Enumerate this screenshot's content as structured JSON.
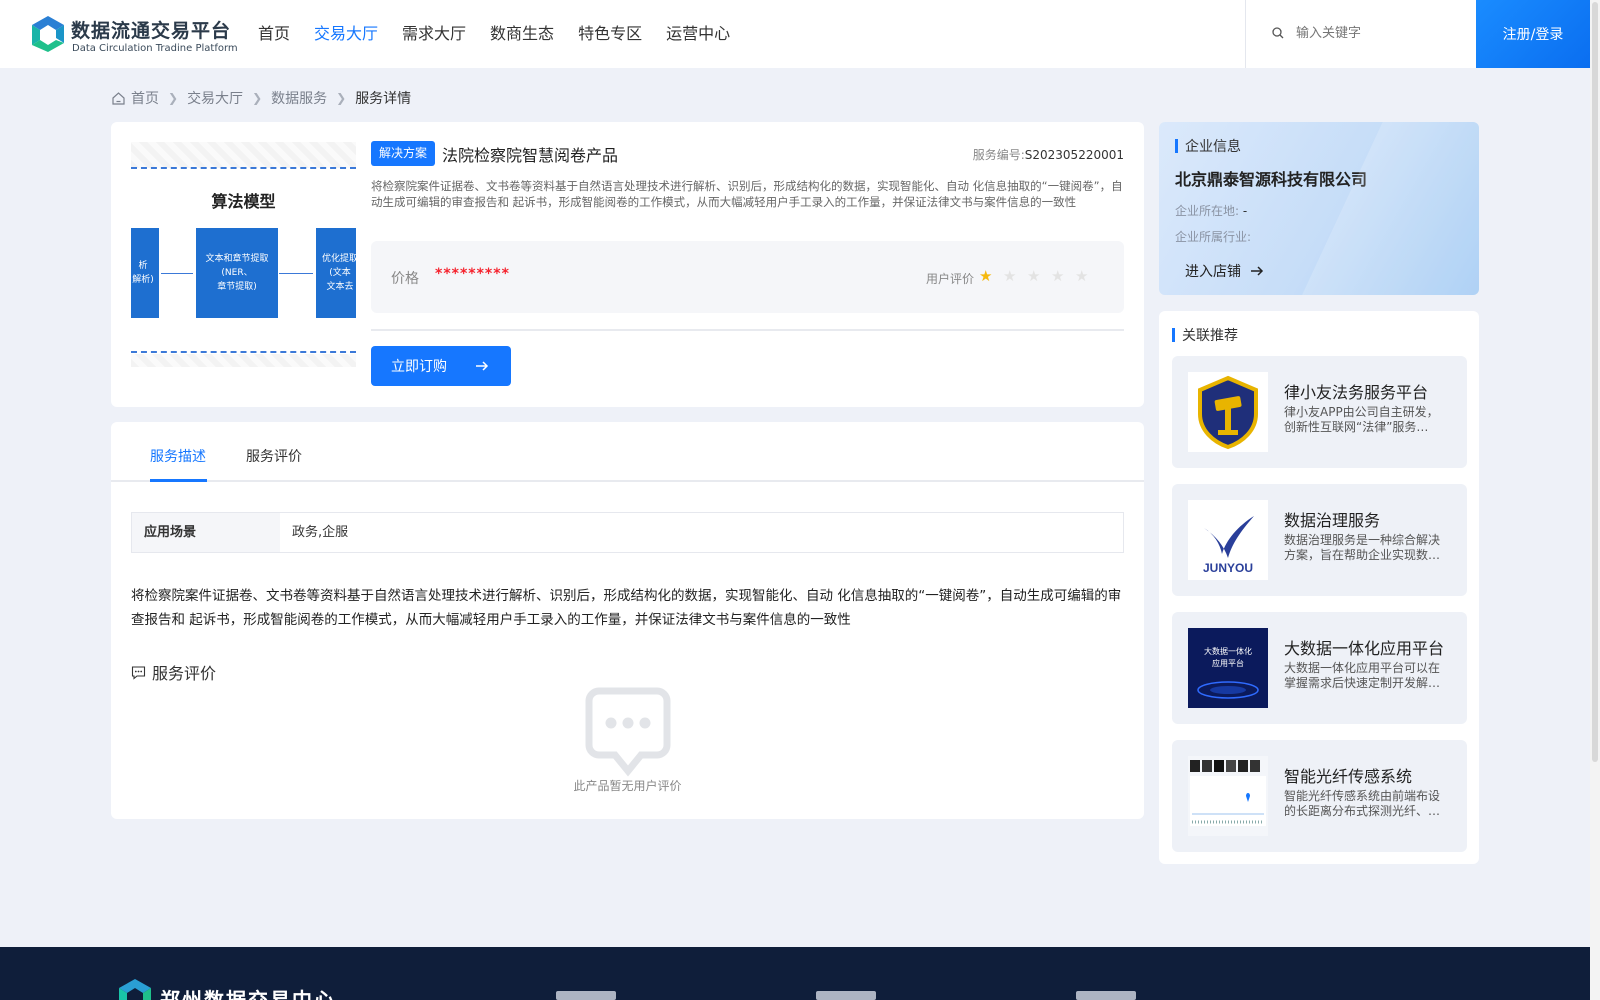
{
  "header": {
    "logo_title": "数据流通交易平台",
    "logo_subtitle": "Data Circulation Tradine Platform",
    "nav": [
      "首页",
      "交易大厅",
      "需求大厅",
      "数商生态",
      "特色专区",
      "运营中心"
    ],
    "nav_active_index": 1,
    "search_placeholder": "输入关键字",
    "login_label": "注册/登录"
  },
  "breadcrumb": [
    "首页",
    "交易大厅",
    "数据服务",
    "服务详情"
  ],
  "product": {
    "image": {
      "title": "算法模型",
      "boxes": [
        "析\n解析)",
        "文本和章节提取\n(NER、\n章节提取)",
        "优化提取\n(文本\n文本去"
      ]
    },
    "tag": "解决方案",
    "title": "法院检察院智慧阅卷产品",
    "service_no_label": "服务编号:",
    "service_no": "S202305220001",
    "description": "将检察院案件证据卷、文书卷等资料基于自然语言处理技术进行解析、识别后，形成结构化的数据，实现智能化、自动 化信息抽取的“一键阅卷”，自动生成可编辑的审查报告和 起诉书，形成智能阅卷的工作模式，从而大幅减轻用户手工录入的工作量，并保证法律文书与案件信息的一致性",
    "price_label": "价格",
    "price_value": "*********",
    "rating_label": "用户评价",
    "rating": 1,
    "rating_max": 5,
    "buy_label": "立即订购"
  },
  "detail": {
    "tabs": [
      "服务描述",
      "服务评价"
    ],
    "active_tab": 0,
    "scene_label": "应用场景",
    "scene_value": "政务,企服",
    "text": "将检察院案件证据卷、文书卷等资料基于自然语言处理技术进行解析、识别后，形成结构化的数据，实现智能化、自动 化信息抽取的“一键阅卷”，自动生成可编辑的审查报告和 起诉书，形成智能阅卷的工作模式，从而大幅减轻用户手工录入的工作量，并保证法律文书与案件信息的一致性",
    "review_title": "服务评价",
    "empty_text": "此产品暂无用户评价"
  },
  "company": {
    "section_title": "企业信息",
    "name": "北京鼎泰智源科技有限公司",
    "location_label": "企业所在地:",
    "location_value": "-",
    "industry_label": "企业所属行业:",
    "industry_value": "",
    "store_label": "进入店铺"
  },
  "related": {
    "section_title": "关联推荐",
    "items": [
      {
        "title": "律小友法务服务平台",
        "desc": "律小友APP由公司自主研发，创新性互联网“法律”服务…"
      },
      {
        "title": "数据治理服务",
        "desc": "数据治理服务是一种综合解决方案，旨在帮助企业实现数…"
      },
      {
        "title": "大数据一体化应用平台",
        "desc": "大数据一体化应用平台可以在掌握需求后快速定制开发解…"
      },
      {
        "title": "智能光纤传感系统",
        "desc": "智能光纤传感系统由前端布设的长距离分布式探测光纤、…"
      }
    ],
    "thumb_texts": {
      "junyou": "JUNYOU",
      "bigdata_line1": "大数据一体化",
      "bigdata_line2": "应用平台"
    }
  },
  "footer": {
    "title": "郑州数据交易中心"
  },
  "colors": {
    "primary": "#1677ff",
    "price": "#f5222d",
    "star_on": "#f5b90e",
    "footer_bg": "#0f1e3a"
  }
}
